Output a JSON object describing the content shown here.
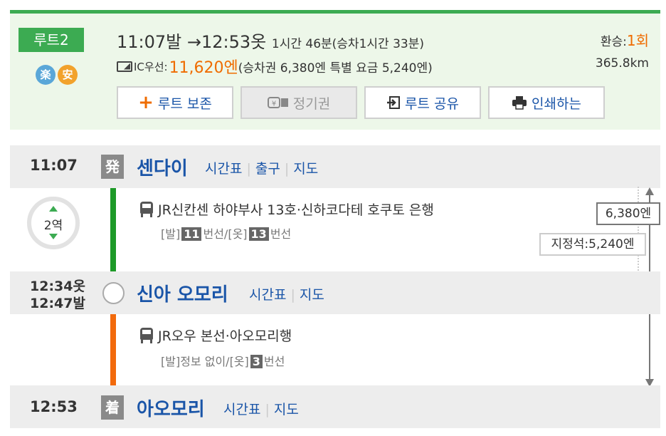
{
  "summary": {
    "route_label": "루트2",
    "badges": [
      {
        "text": "楽",
        "icon": "raku-badge"
      },
      {
        "text": "安",
        "icon": "an-badge"
      }
    ],
    "depart_time": "11:07발",
    "arrow": "→",
    "arrive_time": "12:53옷",
    "duration": "1시간 46분(승차1시간 33분)",
    "transfer_label": "환승:",
    "transfer_count": "1회",
    "ic_label": "IC우선:",
    "total_fare": "11,620엔",
    "fare_detail": "(승차권 6,380엔 특별 요금 5,240엔)",
    "distance": "365.8km",
    "colors": {
      "accent": "#3cab52",
      "highlight": "#ef6c00",
      "link": "#1a55a8"
    }
  },
  "actions": {
    "save_label": "루트 보존",
    "commuter_label": "정기권",
    "share_label": "루트 공유",
    "print_label": "인쇄하는"
  },
  "stations": [
    {
      "time": "11:07",
      "mark": "発",
      "name": "센다이",
      "links": [
        "시간표",
        "출구",
        "지도"
      ]
    },
    {
      "time_arr": "12:34옷",
      "time_dep": "12:47발",
      "name": "신아 오모리",
      "links": [
        "시간표",
        "지도"
      ]
    },
    {
      "time": "12:53",
      "mark": "着",
      "name": "아오모리",
      "links": [
        "시간표",
        "지도"
      ]
    }
  ],
  "segments": [
    {
      "stops": "2역",
      "train": "JR신칸센 하야부사 13호·신하코다테 호쿠토 은행",
      "platform_dep_prefix": "[발]",
      "platform_dep_num": "11",
      "platform_dep_suffix": "번선/",
      "platform_arr_prefix": "[옷]",
      "platform_arr_num": "13",
      "platform_arr_suffix": "번선",
      "line_color": "#1e9a28",
      "fare": "6,380엔",
      "seat_fare": "지정석:5,240엔"
    },
    {
      "train": "JR오우 본선·아오모리행",
      "platform_dep": "[발]정보 없이/",
      "platform_arr_prefix": "[옷]",
      "platform_arr_num": "3",
      "platform_arr_suffix": "번선",
      "line_color": "#f26a0c"
    }
  ]
}
